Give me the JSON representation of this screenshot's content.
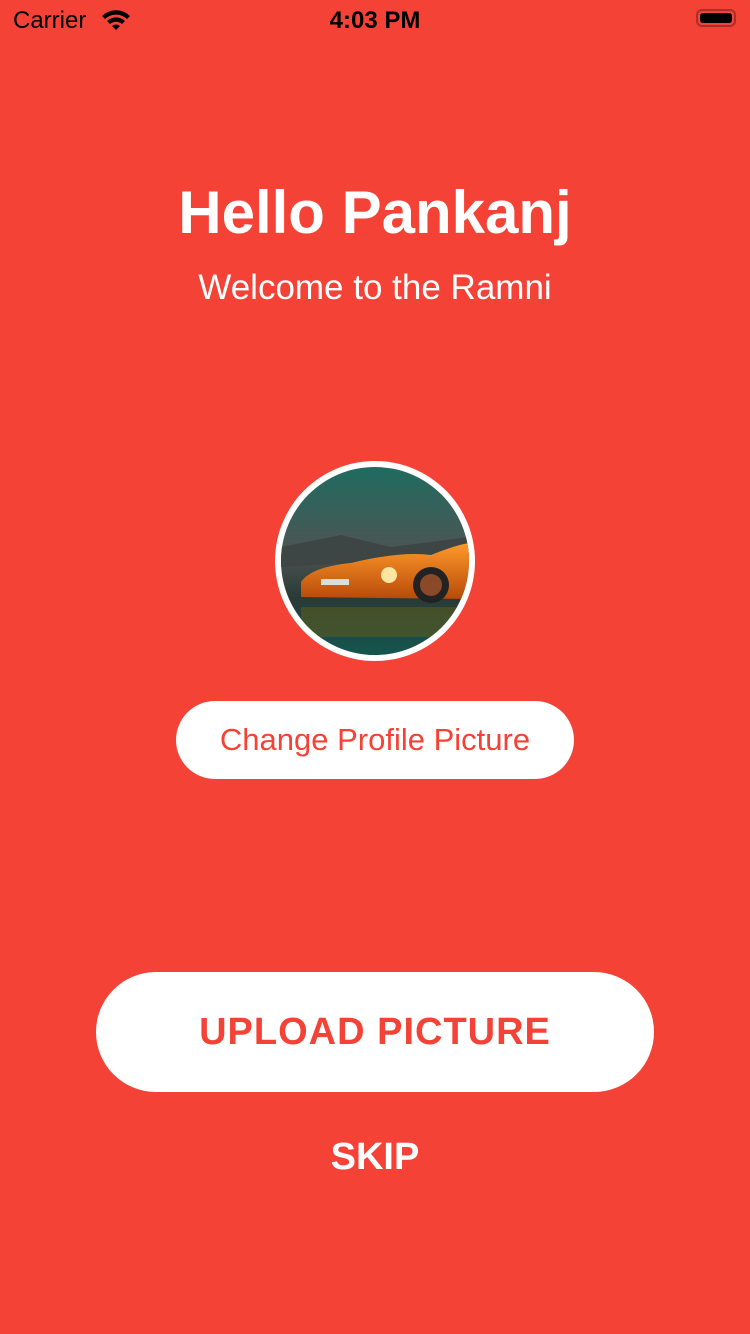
{
  "status_bar": {
    "carrier": "Carrier",
    "time": "4:03 PM",
    "wifi_icon": "wifi-icon",
    "battery_icon": "battery-icon"
  },
  "header": {
    "title": "Hello Pankanj",
    "subtitle": "Welcome to the Ramni"
  },
  "profile": {
    "change_label": "Change Profile Picture"
  },
  "actions": {
    "upload_label": "UPLOAD PICTURE",
    "skip_label": "SKIP"
  },
  "colors": {
    "background": "#F44336",
    "button_bg": "#FFFFFF",
    "button_text": "#F44336"
  }
}
